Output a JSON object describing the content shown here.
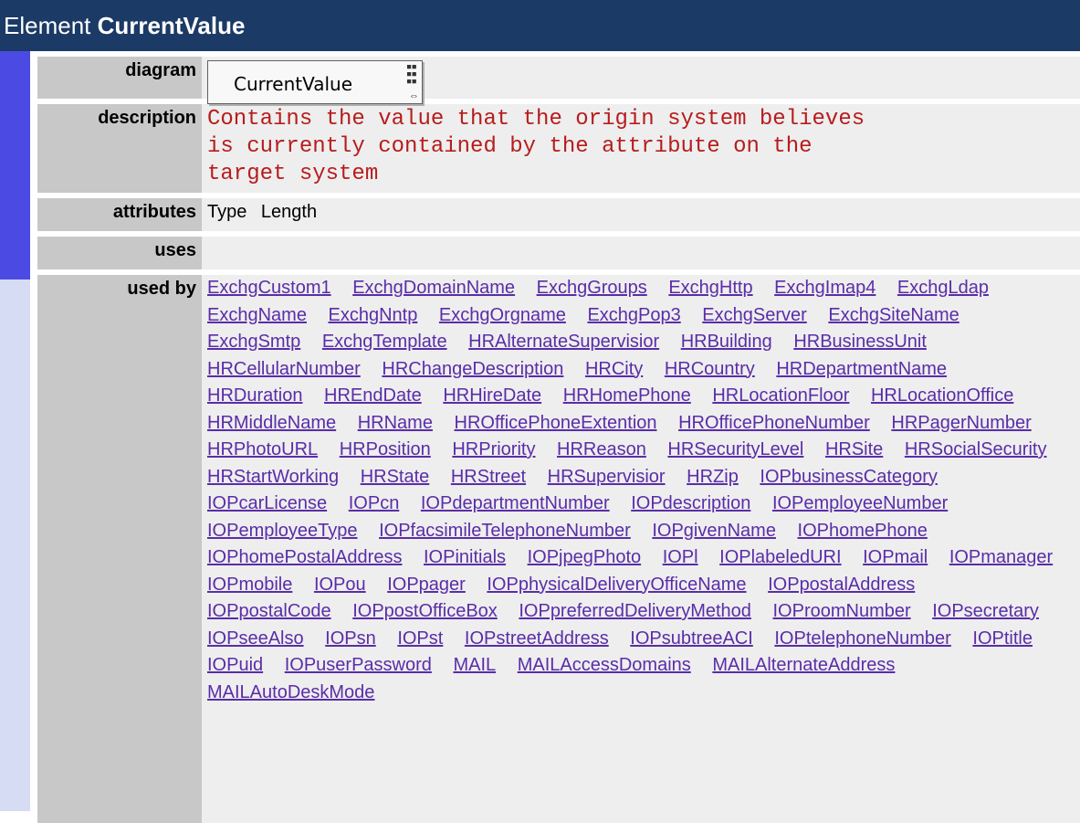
{
  "header": {
    "prefix": "Element",
    "name": "CurrentValue"
  },
  "rows": {
    "diagram_label": "diagram",
    "description_label": "description",
    "attributes_label": "attributes",
    "uses_label": "uses",
    "usedby_label": "used by"
  },
  "diagram": {
    "element_name": "CurrentValue",
    "seq_icon": "sequence-icon",
    "any_icon": "any-attribute-icon"
  },
  "description": "Contains the value that the origin system believes\nis currently contained by the attribute on the\ntarget system",
  "attributes": [
    "Type",
    "Length"
  ],
  "used_by": [
    "ExchgCustom1",
    "ExchgDomainName",
    "ExchgGroups",
    "ExchgHttp",
    "ExchgImap4",
    "ExchgLdap",
    "ExchgName",
    "ExchgNntp",
    "ExchgOrgname",
    "ExchgPop3",
    "ExchgServer",
    "ExchgSiteName",
    "ExchgSmtp",
    "ExchgTemplate",
    "HRAlternateSupervisior",
    "HRBuilding",
    "HRBusinessUnit",
    "HRCellularNumber",
    "HRChangeDescription",
    "HRCity",
    "HRCountry",
    "HRDepartmentName",
    "HRDuration",
    "HREndDate",
    "HRHireDate",
    "HRHomePhone",
    "HRLocationFloor",
    "HRLocationOffice",
    "HRMiddleName",
    "HRName",
    "HROfficePhoneExtention",
    "HROfficePhoneNumber",
    "HRPagerNumber",
    "HRPhotoURL",
    "HRPosition",
    "HRPriority",
    "HRReason",
    "HRSecurityLevel",
    "HRSite",
    "HRSocialSecurity",
    "HRStartWorking",
    "HRState",
    "HRStreet",
    "HRSupervisior",
    "HRZip",
    "IOPbusinessCategory",
    "IOPcarLicense",
    "IOPcn",
    "IOPdepartmentNumber",
    "IOPdescription",
    "IOPemployeeNumber",
    "IOPemployeeType",
    "IOPfacsimileTelephoneNumber",
    "IOPgivenName",
    "IOPhomePhone",
    "IOPhomePostalAddress",
    "IOPinitials",
    "IOPjpegPhoto",
    "IOPl",
    "IOPlabeledURI",
    "IOPmail",
    "IOPmanager",
    "IOPmobile",
    "IOPou",
    "IOPpager",
    "IOPphysicalDeliveryOfficeName",
    "IOPpostalAddress",
    "IOPpostalCode",
    "IOPpostOfficeBox",
    "IOPpreferredDeliveryMethod",
    "IOProomNumber",
    "IOPsecretary",
    "IOPseeAlso",
    "IOPsn",
    "IOPst",
    "IOPstreetAddress",
    "IOPsubtreeACI",
    "IOPtelephoneNumber",
    "IOPtitle",
    "IOPuid",
    "IOPuserPassword",
    "MAIL",
    "MAILAccessDomains",
    "MAILAlternateAddress",
    "MAILAutoDeskMode"
  ]
}
